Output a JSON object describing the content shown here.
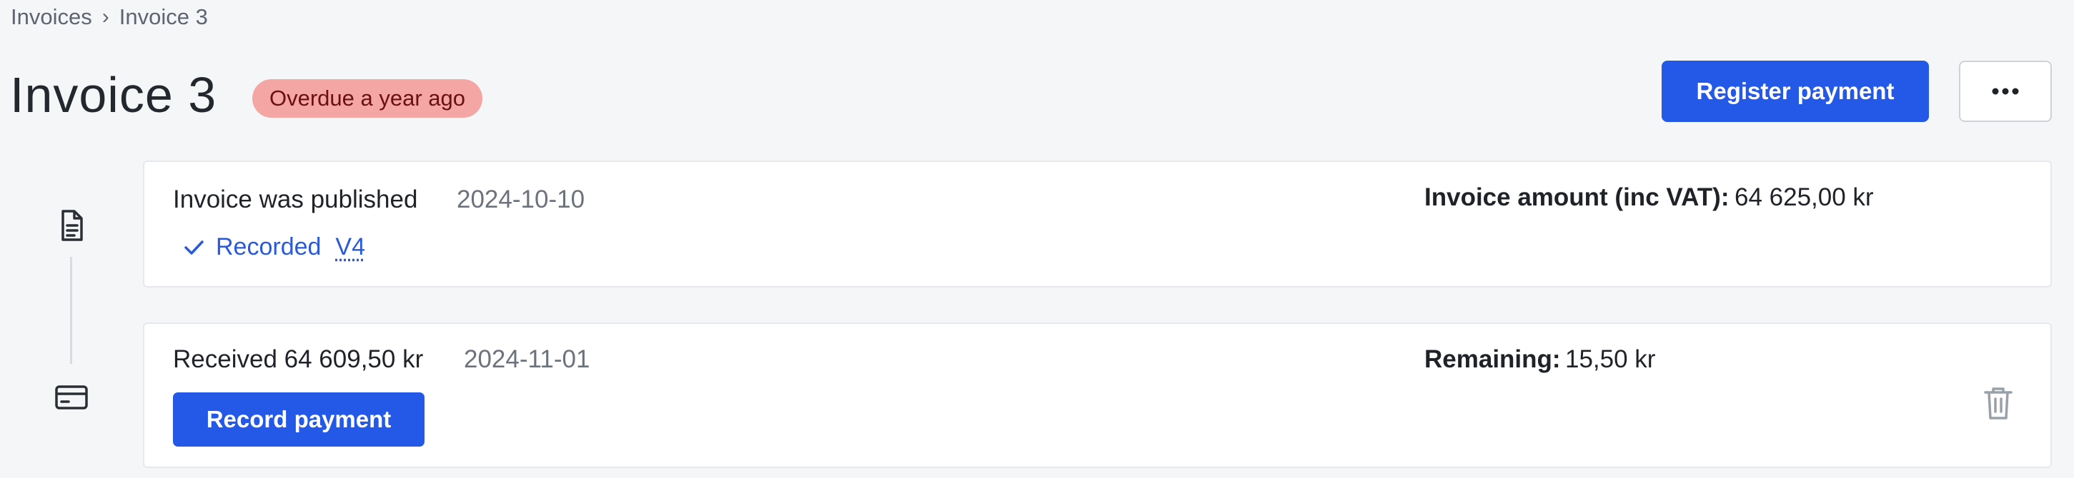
{
  "breadcrumb": {
    "parent": "Invoices",
    "separator": "›",
    "current": "Invoice 3"
  },
  "header": {
    "title": "Invoice 3",
    "status_badge": "Overdue a year ago",
    "register_payment_label": "Register payment",
    "more_label": "•••"
  },
  "events": {
    "published": {
      "label": "Invoice was published",
      "date": "2024-10-10",
      "recorded_label": "Recorded",
      "voucher": "V4",
      "amount_label": "Invoice amount (inc VAT):",
      "amount_value": "64 625,00 kr"
    },
    "payment": {
      "label": "Received 64 609,50 kr",
      "date": "2024-11-01",
      "record_button_label": "Record payment",
      "remaining_label": "Remaining:",
      "remaining_value": "15,50 kr"
    }
  },
  "colors": {
    "primary": "#2458e6",
    "badge_bg": "#f3a6a3",
    "badge_text": "#6b0f12",
    "link": "#2a5ad7"
  },
  "icons": {
    "published": "document-icon",
    "payment": "credit-card-icon",
    "recorded": "check-icon",
    "delete": "trash-icon",
    "more": "more-horizontal-icon"
  }
}
